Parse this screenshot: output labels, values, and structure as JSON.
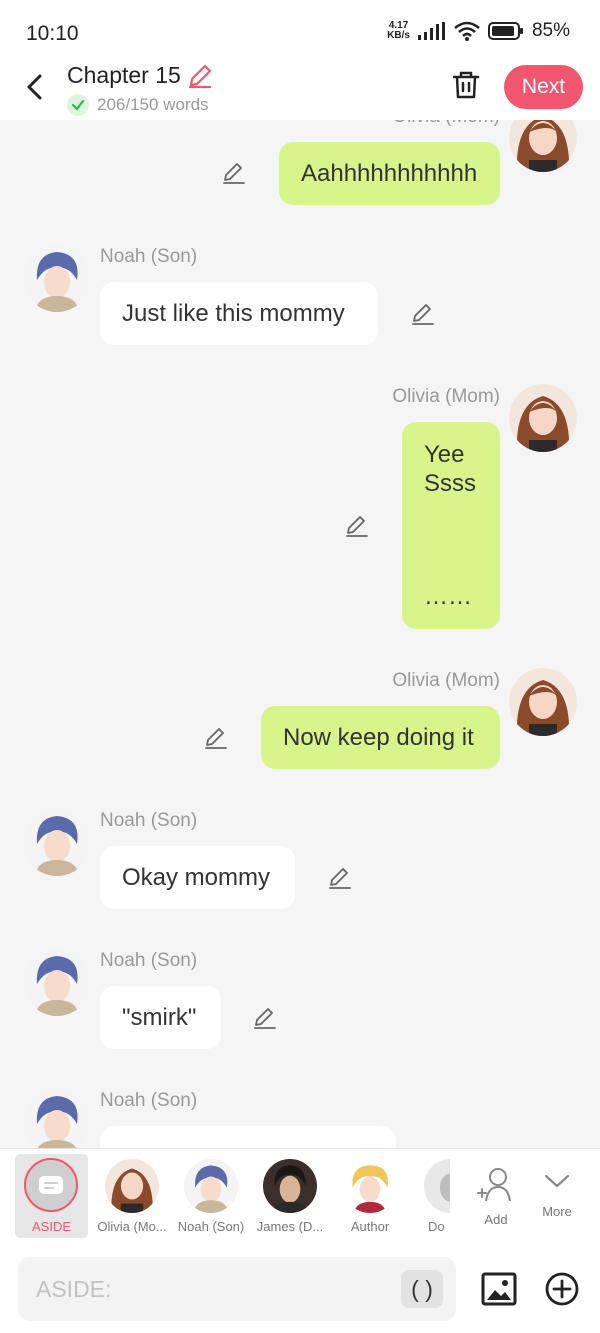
{
  "status_bar": {
    "time": "10:10",
    "net_speed_value": "4.17",
    "net_speed_unit": "KB/s",
    "battery": "85%"
  },
  "header": {
    "title": "Chapter 15",
    "word_count": "206/150 words",
    "next_label": "Next",
    "accent_color": "#f0566e"
  },
  "messages": [
    {
      "side": "right",
      "name": "Olivia (Mom)",
      "text": "Aahhhhhhhhhhh"
    },
    {
      "side": "left",
      "name": "Noah (Son)",
      "text": "Just like this mommy"
    },
    {
      "side": "right",
      "name": "Olivia (Mom)",
      "line1": "Yee",
      "line2": "Ssss",
      "line3": "……"
    },
    {
      "side": "right",
      "name": "Olivia (Mom)",
      "text": "Now keep doing it"
    },
    {
      "side": "left",
      "name": "Noah (Son)",
      "text": "Okay mommy"
    },
    {
      "side": "left",
      "name": "Noah (Son)",
      "text": "\"smirk\""
    },
    {
      "side": "left",
      "name": "Noah (Son)",
      "text": ""
    }
  ],
  "characters": {
    "aside": "ASIDE",
    "olivia": "Olivia (Mo...",
    "noah": "Noah (Son)",
    "james": "James (D...",
    "author": "Author",
    "partial": "Do",
    "add": "Add",
    "more": "More"
  },
  "input": {
    "placeholder": "ASIDE:",
    "paren_button": "( )"
  }
}
